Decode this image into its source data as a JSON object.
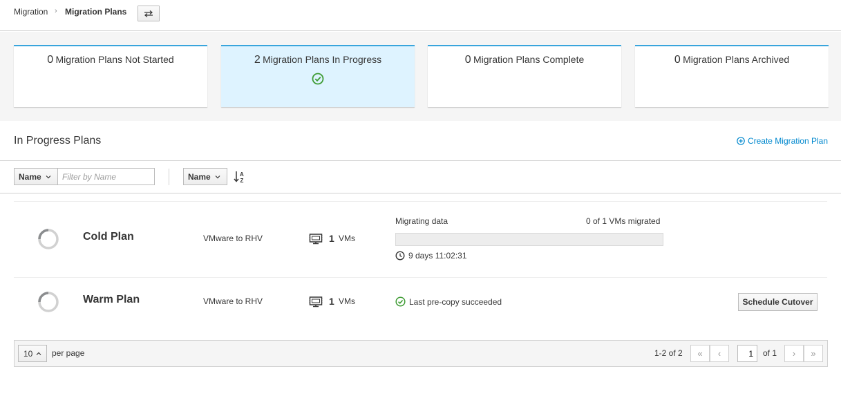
{
  "breadcrumb": {
    "root": "Migration",
    "separator": "›",
    "current": "Migration Plans",
    "swap_icon": "swap-arrows-icon"
  },
  "cards": [
    {
      "count": "0",
      "label": "Migration Plans Not Started",
      "active": false
    },
    {
      "count": "2",
      "label": "Migration Plans In Progress",
      "active": true,
      "icon": "check-circle-icon"
    },
    {
      "count": "0",
      "label": "Migration Plans Complete",
      "active": false
    },
    {
      "count": "0",
      "label": "Migration Plans Archived",
      "active": false
    }
  ],
  "section": {
    "title": "In Progress Plans",
    "create_label": "Create Migration Plan"
  },
  "toolbar": {
    "filter_field": "Name",
    "filter_placeholder": "Filter by Name",
    "sort_field": "Name",
    "sort_icon": "sort-alpha-asc-icon"
  },
  "plans": [
    {
      "name": "Cold Plan",
      "type": "VMware to RHV",
      "vm_count": "1",
      "vm_label": "VMs",
      "status_title": "Migrating data",
      "status_right": "0 of 1 VMs migrated",
      "progress": 0,
      "elapsed": "9 days 11:02:31"
    },
    {
      "name": "Warm Plan",
      "type": "VMware to RHV",
      "vm_count": "1",
      "vm_label": "VMs",
      "status_text": "Last pre-copy succeeded",
      "action_label": "Schedule Cutover"
    }
  ],
  "pagination": {
    "per_page": "10",
    "per_page_label": "per page",
    "range": "1-2 of 2",
    "current_page": "1",
    "of_pages": "of 1"
  },
  "colors": {
    "accent": "#0088ce",
    "card_border": "#39a5dc",
    "active_card_bg": "#def3ff",
    "success": "#3f9c35"
  }
}
